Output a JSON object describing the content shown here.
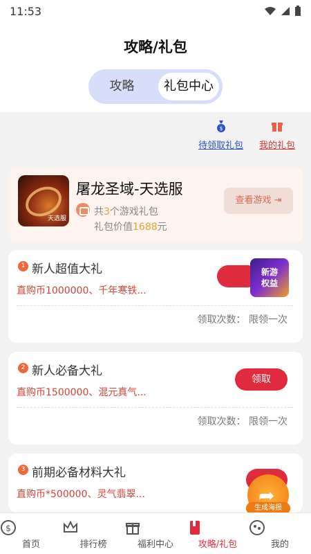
{
  "status_bar": {
    "time": "11:53"
  },
  "page_title": "攻略/礼包",
  "segment": {
    "tab_guide": "攻略",
    "tab_gift_center": "礼包中心"
  },
  "gift_links": {
    "pending": "待领取礼包",
    "mine": "我的礼包"
  },
  "game": {
    "name": "屠龙圣域-天选服",
    "count_prefix": "共",
    "count": "3",
    "count_suffix": "个游戏礼包",
    "value_prefix": "礼包价值",
    "value": "1688",
    "value_suffix": "元",
    "view_button": "查看游戏",
    "cover_tag": "天选服"
  },
  "packs": [
    {
      "index": "1",
      "title": "新人超值大礼",
      "desc": "直购币1000000、千年寒铁...",
      "claim_label": "领取次数：",
      "claim_limit": "限领一次",
      "promo": "新游\n权益"
    },
    {
      "index": "2",
      "title": "新人必备大礼",
      "desc": "直购币1500000、混元真气...",
      "claim_label": "领取次数：",
      "claim_limit": "限领一次",
      "button": "领取"
    },
    {
      "index": "3",
      "title": "前期必备材料大礼",
      "desc": "直购币*500000、灵气翡翠..."
    }
  ],
  "share_fab": {
    "label": "生成海报"
  },
  "tabbar": {
    "items": [
      {
        "label": "首页",
        "icon": "home-coin-icon"
      },
      {
        "label": "排行榜",
        "icon": "crown-icon"
      },
      {
        "label": "福利中心",
        "icon": "gift-box-icon"
      },
      {
        "label": "攻略/礼包",
        "icon": "book-icon"
      },
      {
        "label": "我的",
        "icon": "profile-icon"
      }
    ],
    "active_index": 3
  },
  "colors": {
    "accent": "#e02a3d",
    "link_blue": "#2a52c9",
    "segment_bg": "#d7defa",
    "highlight": "#e3a23a"
  }
}
